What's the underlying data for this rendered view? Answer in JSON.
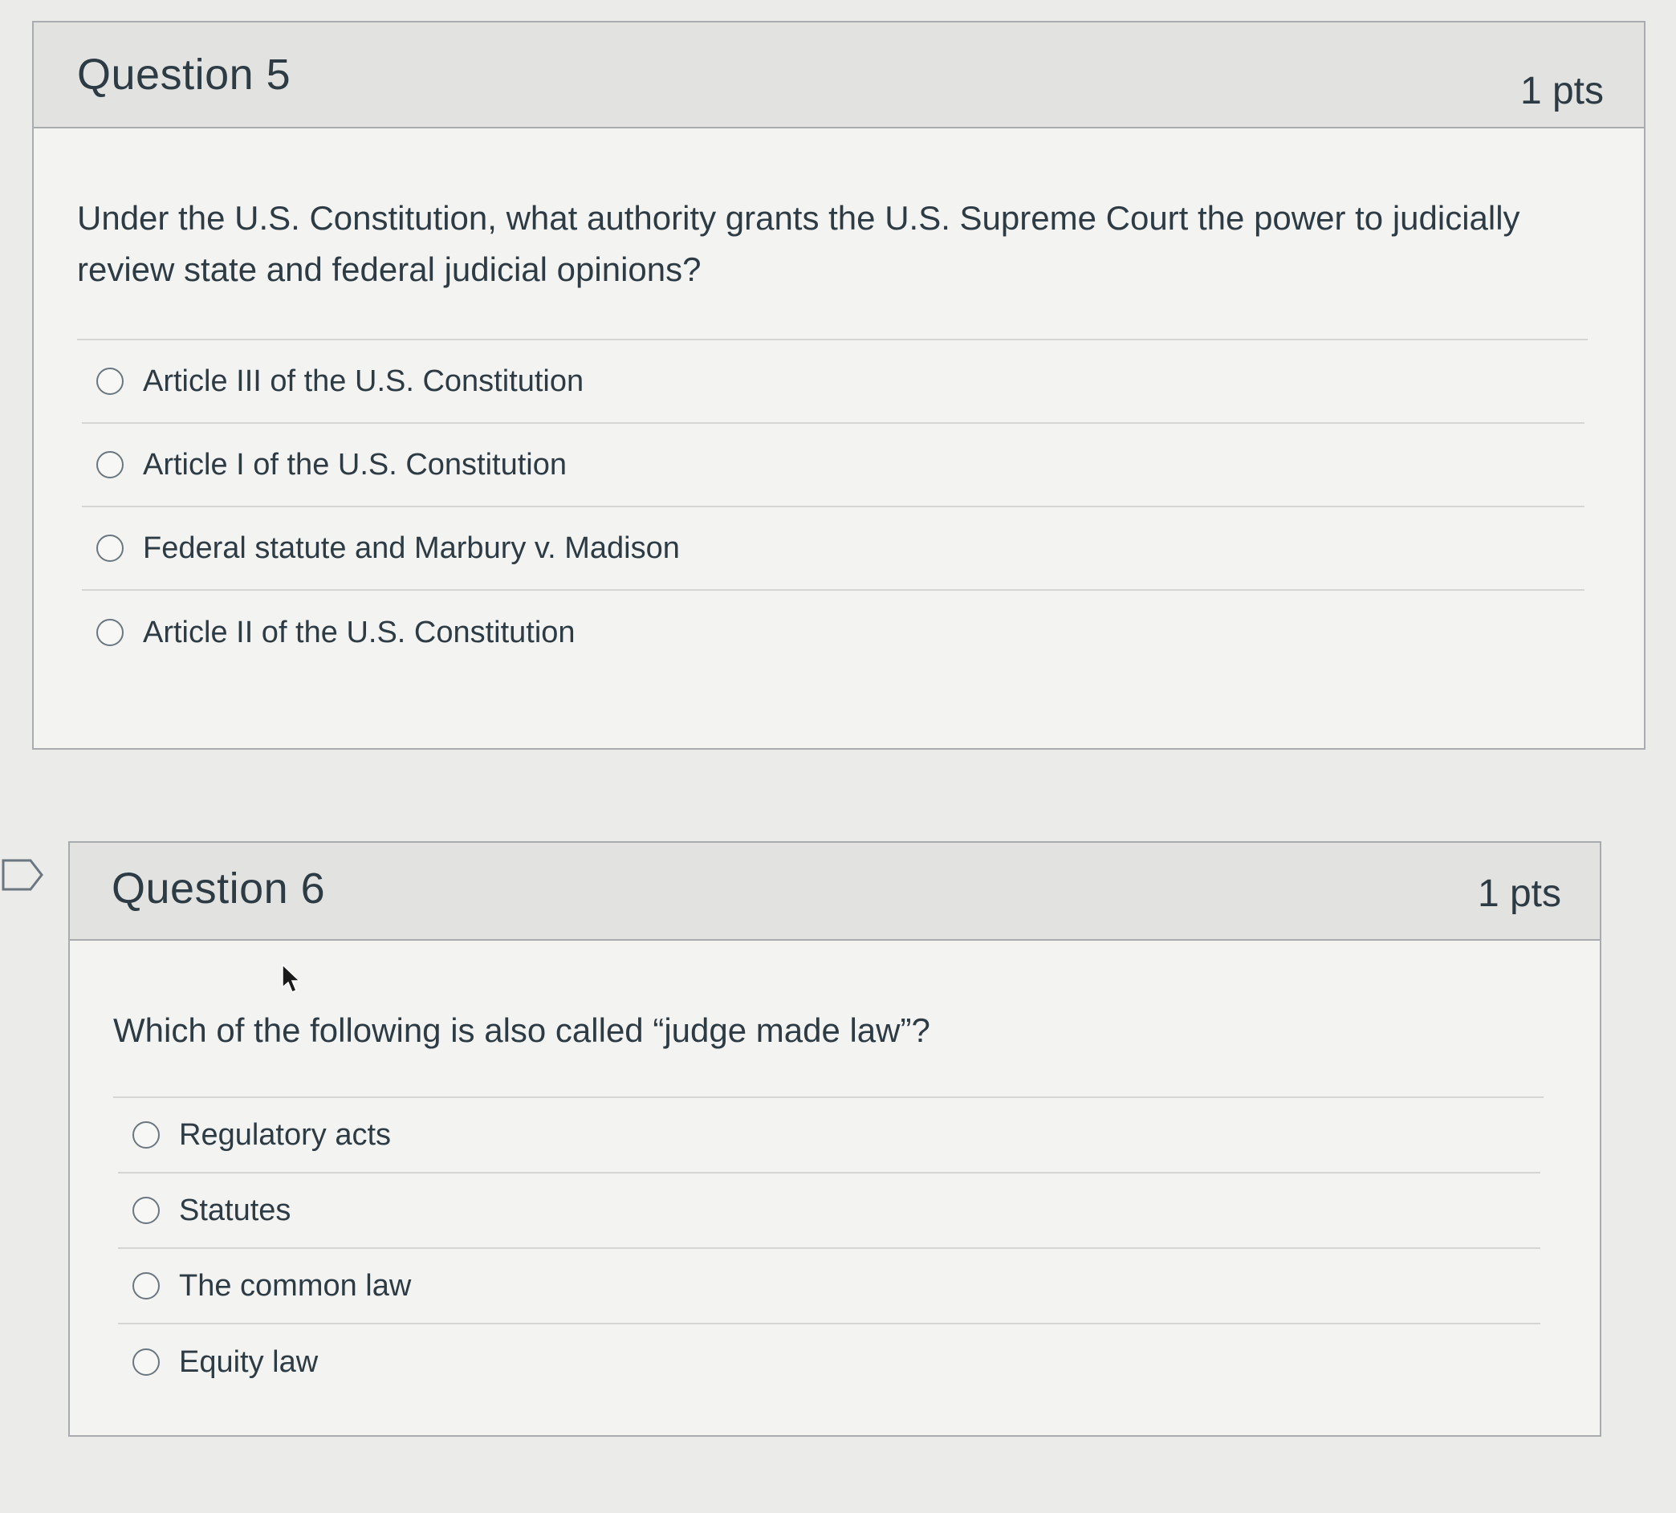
{
  "questions": [
    {
      "title": "Question 5",
      "points": "1 pts",
      "text": "Under the U.S. Constitution, what authority grants the U.S. Supreme Court the power to judicially review state and federal judicial opinions?",
      "answers": [
        "Article III of the U.S. Constitution",
        "Article I of the U.S. Constitution",
        "Federal statute and Marbury v. Madison",
        "Article II of the U.S. Constitution"
      ],
      "flagged": false
    },
    {
      "title": "Question 6",
      "points": "1 pts",
      "text": "Which of the following is also called “judge made law”?",
      "answers": [
        "Regulatory acts",
        "Statutes",
        "The common law",
        "Equity law"
      ],
      "flagged": false
    }
  ],
  "colors": {
    "page_background": "#ebebea",
    "header_background": "#e2e2e0",
    "text": "#2d3b45",
    "border": "#a9acaf"
  },
  "icons": {
    "flag": "flag-outline-icon",
    "radio": "radio-unchecked-icon",
    "cursor": "mouse-pointer-icon"
  }
}
